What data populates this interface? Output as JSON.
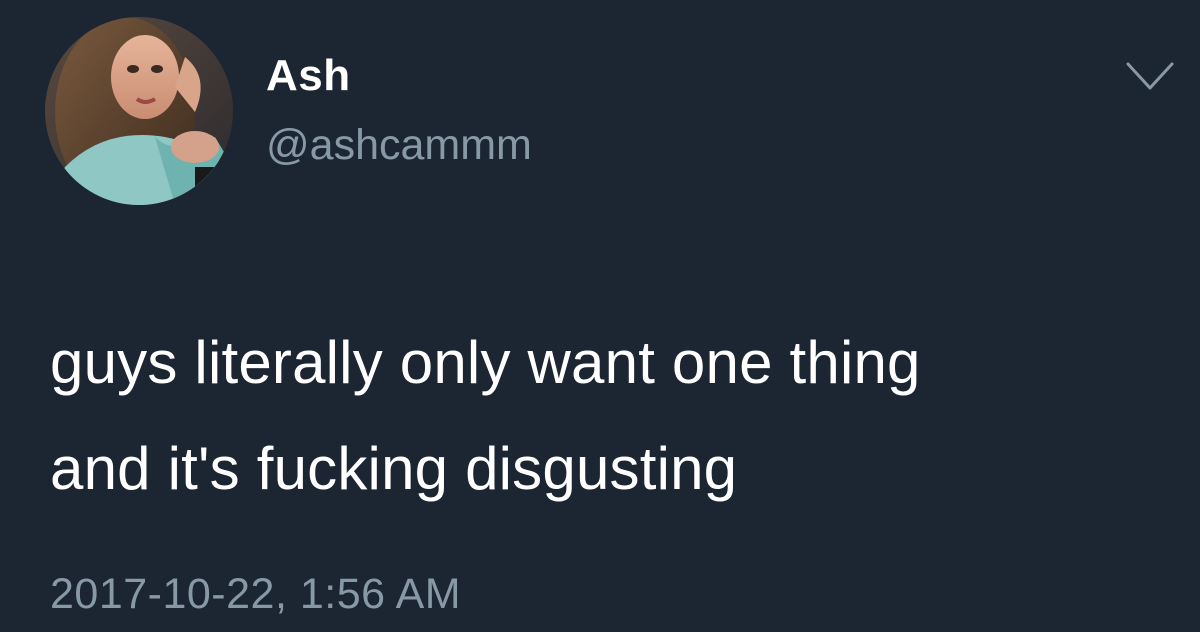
{
  "tweet": {
    "display_name": "Ash",
    "handle": "@ashcammm",
    "text_lines": [
      "guys literally only want one thing",
      "and it's fucking disgusting"
    ],
    "timestamp": "2017-10-22, 1:56 AM",
    "menu_icon": "chevron-down-icon",
    "avatar_icon": "profile-photo"
  },
  "colors": {
    "background": "#1c2532",
    "primary_text": "#ffffff",
    "secondary_text": "#8899a6"
  }
}
